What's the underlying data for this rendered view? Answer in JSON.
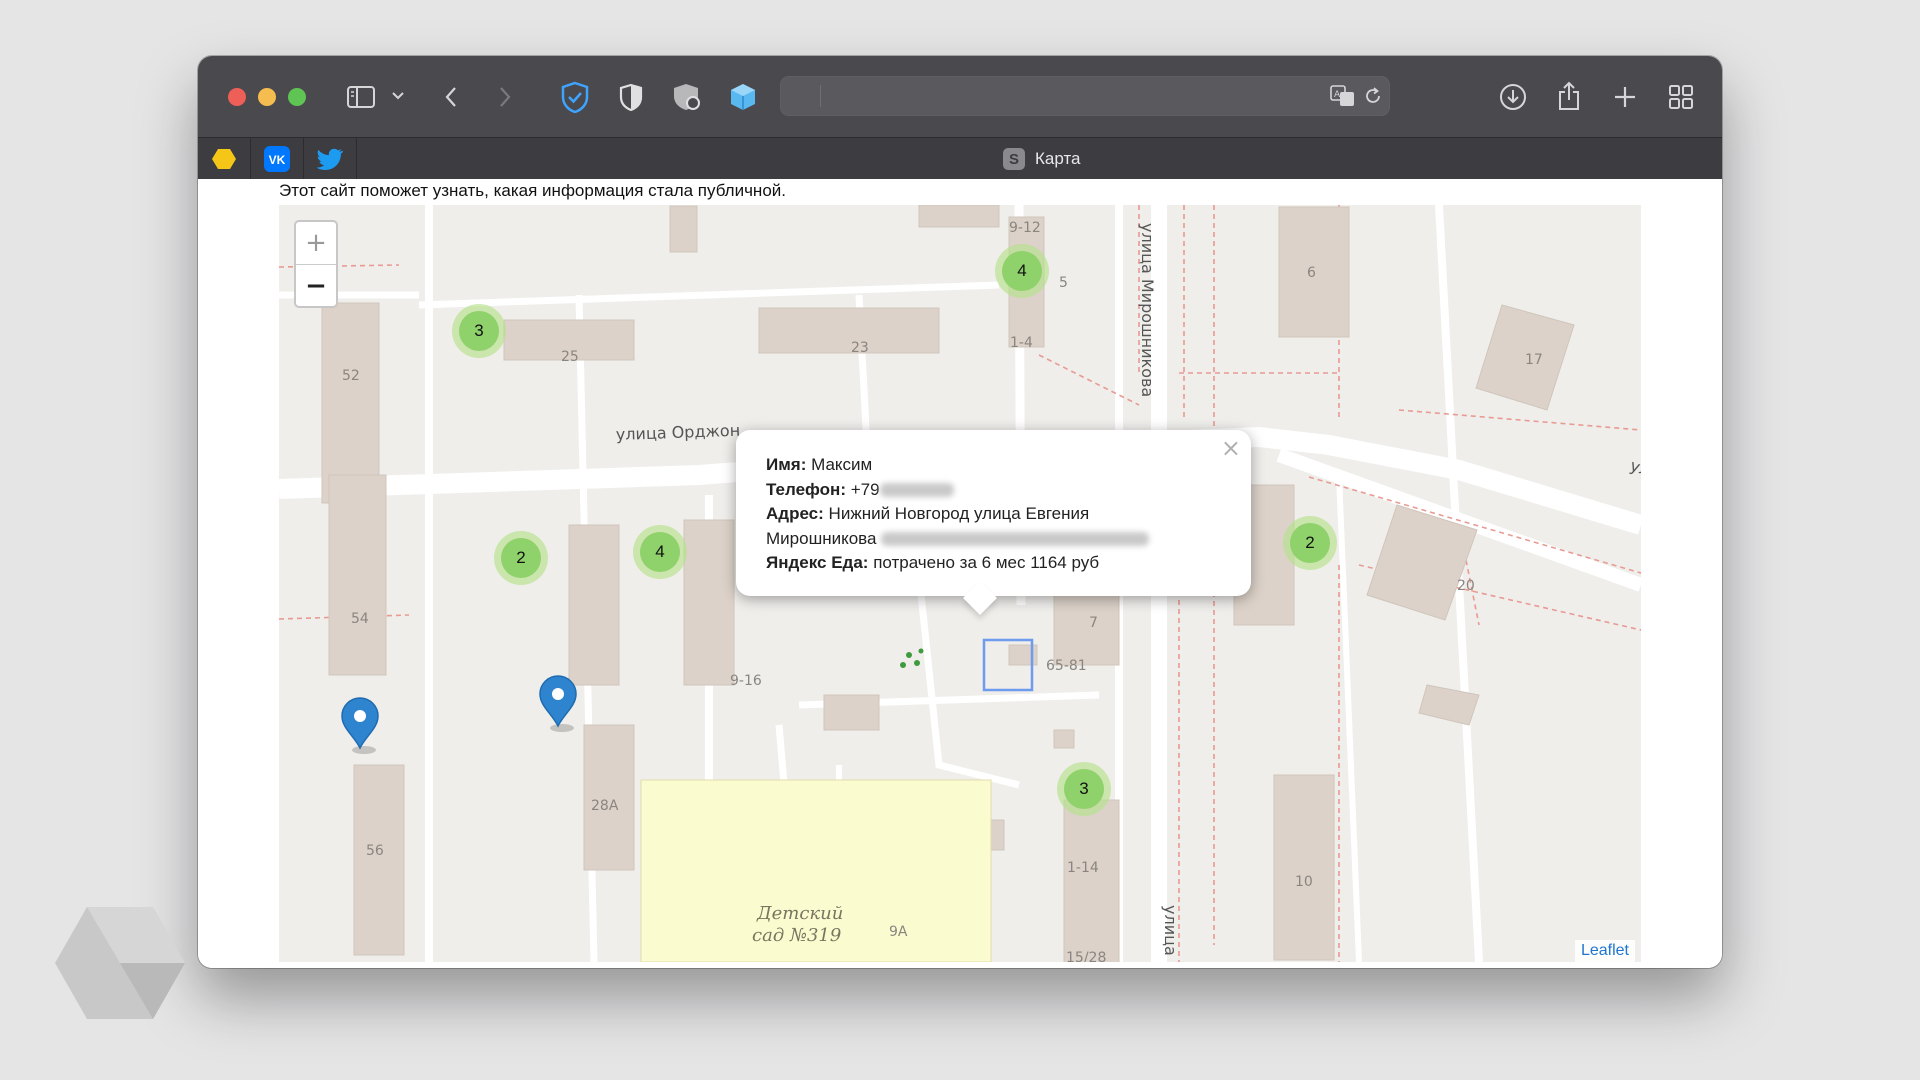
{
  "window": {
    "tabs": {
      "pinned": [
        {
          "name": "pinned-tab-yellow",
          "color": "#f5c518"
        },
        {
          "name": "pinned-tab-vk",
          "label": "VK",
          "color": "#0077ff"
        },
        {
          "name": "pinned-tab-twitter",
          "color": "#1d9bf0"
        }
      ],
      "active": {
        "favicon_letter": "S",
        "title": "Карта"
      }
    },
    "url": ""
  },
  "page": {
    "intro": "Этот сайт поможет узнать, какая информация стала публичной."
  },
  "map": {
    "zoom_in": "+",
    "zoom_out": "−",
    "attribution": "Leaflet",
    "street_labels": {
      "ordzh": "улица Орджон",
      "miroshnikova": "улица Мирошникова",
      "miroshnikova_bottom": "улица",
      "right_edge": "ул"
    },
    "building_labels": [
      "9-12",
      "5",
      "1-4",
      "6",
      "17",
      "52",
      "25",
      "23",
      "54",
      "20",
      "9-16",
      "7",
      "65-81",
      "28A",
      "56",
      "1-14",
      "10",
      "9A",
      "15/28"
    ],
    "kindergarten": {
      "line1": "Детский",
      "line2": "сад №319"
    },
    "clusters": [
      {
        "id": "c1",
        "count": "4"
      },
      {
        "id": "c2",
        "count": "3"
      },
      {
        "id": "c3",
        "count": "2"
      },
      {
        "id": "c4",
        "count": "4"
      },
      {
        "id": "c5",
        "count": "2"
      },
      {
        "id": "c6",
        "count": "3"
      }
    ],
    "popup": {
      "name_label": "Имя:",
      "name_value": "Максим",
      "phone_label": "Телефон:",
      "phone_value": "+79",
      "address_label": "Адрес:",
      "address_value": "Нижний Новгород улица Евгения",
      "address_value2": "Мирошникова",
      "food_label": "Яндекс Еда:",
      "food_value": "потрачено за 6 мес 1164 руб",
      "close": "×"
    }
  }
}
